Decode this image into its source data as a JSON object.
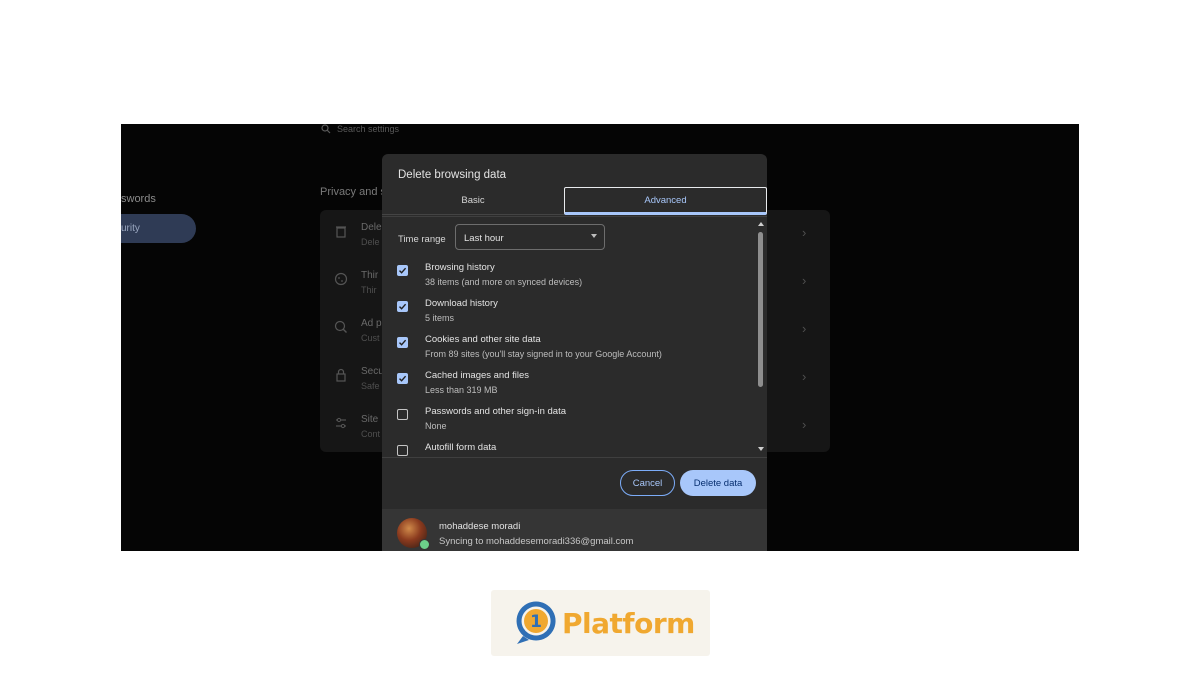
{
  "background": {
    "search_placeholder": "Search settings",
    "sidebar_fragments": [
      "swords",
      "urity"
    ],
    "section_title": "Privacy and s",
    "rows": [
      {
        "icon": "trash-icon",
        "line1": "Dele",
        "line2": "Dele"
      },
      {
        "icon": "cookie-icon",
        "line1": "Thir",
        "line2": "Thir"
      },
      {
        "icon": "ad-privacy-icon",
        "line1": "Ad p",
        "line2": "Cust"
      },
      {
        "icon": "lock-icon",
        "line1": "Secu",
        "line2": "Safe"
      },
      {
        "icon": "sliders-icon",
        "line1": "Site",
        "line2": "Cont"
      }
    ]
  },
  "dialog": {
    "title": "Delete browsing data",
    "tabs": [
      {
        "label": "Basic",
        "selected": false
      },
      {
        "label": "Advanced",
        "selected": true
      }
    ],
    "time_range": {
      "label": "Time range",
      "value": "Last hour"
    },
    "items": [
      {
        "title": "Browsing history",
        "subtitle": "38 items (and more on synced devices)",
        "checked": true
      },
      {
        "title": "Download history",
        "subtitle": "5 items",
        "checked": true
      },
      {
        "title": "Cookies and other site data",
        "subtitle": "From 89 sites (you'll stay signed in to your Google Account)",
        "checked": true
      },
      {
        "title": "Cached images and files",
        "subtitle": "Less than 319 MB",
        "checked": true
      },
      {
        "title": "Passwords and other sign-in data",
        "subtitle": "None",
        "checked": false
      },
      {
        "title": "Autofill form data",
        "subtitle": "",
        "checked": false
      }
    ],
    "buttons": {
      "cancel": "Cancel",
      "delete": "Delete data"
    },
    "account": {
      "name": "mohaddese moradi",
      "sync": "Syncing to mohaddesemoradi336@gmail.com"
    }
  },
  "logo": {
    "digit": "1",
    "text": "Platform"
  },
  "colors": {
    "accent": "#a8c7fa",
    "dialog_bg": "#2b2b2b",
    "logo_orange": "#f0a830",
    "logo_blue": "#2f6fb5"
  }
}
